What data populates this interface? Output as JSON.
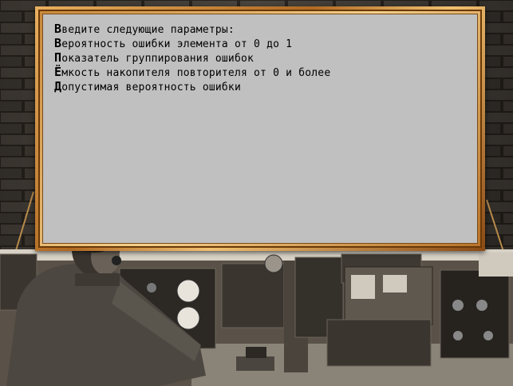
{
  "prompt_lines": [
    {
      "first": "В",
      "rest": "ведите следующие параметры:"
    },
    {
      "first": "В",
      "rest": "ероятность ошибки элемента от 0 до 1"
    },
    {
      "first": "П",
      "rest": "оказатель группирования ошибок"
    },
    {
      "first": "Ё",
      "rest": "мкость накопителя повторителя от 0 и более"
    },
    {
      "first": "Д",
      "rest": "опустимая вероятность ошибки"
    }
  ],
  "colors": {
    "panel": "#c0c0c0",
    "frame_gold": "#d89a48",
    "text": "#000000"
  }
}
